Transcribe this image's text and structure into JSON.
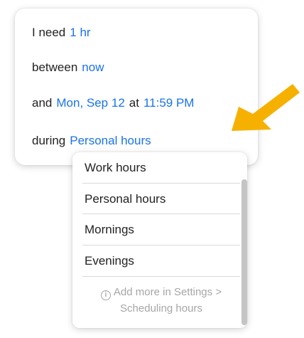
{
  "scheduler": {
    "need_label": "I need",
    "duration": "1 hr",
    "between_label": "between",
    "start": "now",
    "and_label": "and",
    "end_date": "Mon, Sep 12",
    "at_label": "at",
    "end_time": "11:59 PM",
    "during_label": "during",
    "hours_selection": "Personal hours"
  },
  "dropdown": {
    "options": [
      "Work hours",
      "Personal hours",
      "Mornings",
      "Evenings"
    ],
    "hint_icon": "info-icon",
    "hint_line1": "Add more in Settings >",
    "hint_line2": "Scheduling hours"
  },
  "colors": {
    "link": "#1a73e8",
    "arrow": "#f6b100"
  }
}
